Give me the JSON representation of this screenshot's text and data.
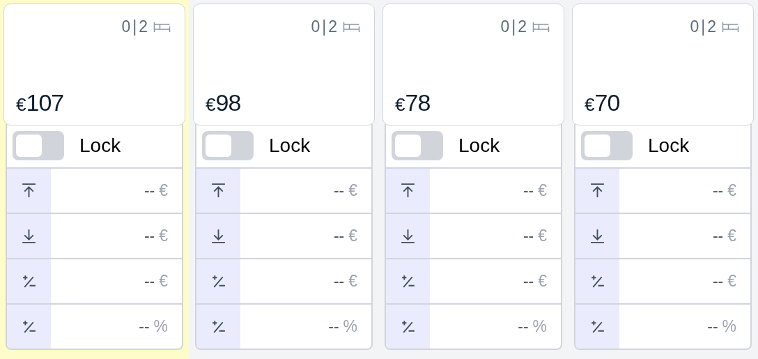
{
  "columns": [
    {
      "highlighted": true,
      "beds": "0|2",
      "currency": "€",
      "price": "107",
      "lock": {
        "label": "Lock",
        "on": false
      },
      "rows": [
        {
          "kind": "max",
          "value": "--",
          "unit": "€"
        },
        {
          "kind": "min",
          "value": "--",
          "unit": "€"
        },
        {
          "kind": "adjust",
          "value": "--",
          "unit": "€"
        },
        {
          "kind": "adjust",
          "value": "--",
          "unit": "%"
        }
      ]
    },
    {
      "highlighted": false,
      "beds": "0|2",
      "currency": "€",
      "price": "98",
      "lock": {
        "label": "Lock",
        "on": false
      },
      "rows": [
        {
          "kind": "max",
          "value": "--",
          "unit": "€"
        },
        {
          "kind": "min",
          "value": "--",
          "unit": "€"
        },
        {
          "kind": "adjust",
          "value": "--",
          "unit": "€"
        },
        {
          "kind": "adjust",
          "value": "--",
          "unit": "%"
        }
      ]
    },
    {
      "highlighted": false,
      "beds": "0|2",
      "currency": "€",
      "price": "78",
      "lock": {
        "label": "Lock",
        "on": false
      },
      "rows": [
        {
          "kind": "max",
          "value": "--",
          "unit": "€"
        },
        {
          "kind": "min",
          "value": "--",
          "unit": "€"
        },
        {
          "kind": "adjust",
          "value": "--",
          "unit": "€"
        },
        {
          "kind": "adjust",
          "value": "--",
          "unit": "%"
        }
      ]
    },
    {
      "highlighted": false,
      "beds": "0|2",
      "currency": "€",
      "price": "70",
      "lock": {
        "label": "Lock",
        "on": false
      },
      "rows": [
        {
          "kind": "max",
          "value": "--",
          "unit": "€"
        },
        {
          "kind": "min",
          "value": "--",
          "unit": "€"
        },
        {
          "kind": "adjust",
          "value": "--",
          "unit": "€"
        },
        {
          "kind": "adjust",
          "value": "--",
          "unit": "%"
        }
      ]
    }
  ]
}
